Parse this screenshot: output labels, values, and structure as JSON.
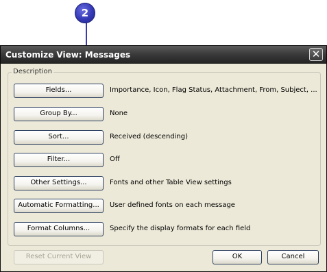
{
  "callout": {
    "number": "2"
  },
  "dialog": {
    "title": "Customize View: Messages",
    "close_glyph": "✕",
    "group_label": "Description",
    "rows": [
      {
        "button": "Fields...",
        "value": "Importance, Icon, Flag Status, Attachment, From, Subject, ..."
      },
      {
        "button": "Group By...",
        "value": "None"
      },
      {
        "button": "Sort...",
        "value": "Received (descending)"
      },
      {
        "button": "Filter...",
        "value": "Off"
      },
      {
        "button": "Other Settings...",
        "value": "Fonts and other Table View settings"
      },
      {
        "button": "Automatic Formatting...",
        "value": "User defined fonts on each message"
      },
      {
        "button": "Format Columns...",
        "value": "Specify the display formats for each field"
      }
    ],
    "reset_button": "Reset Current View",
    "ok_button": "OK",
    "cancel_button": "Cancel"
  }
}
